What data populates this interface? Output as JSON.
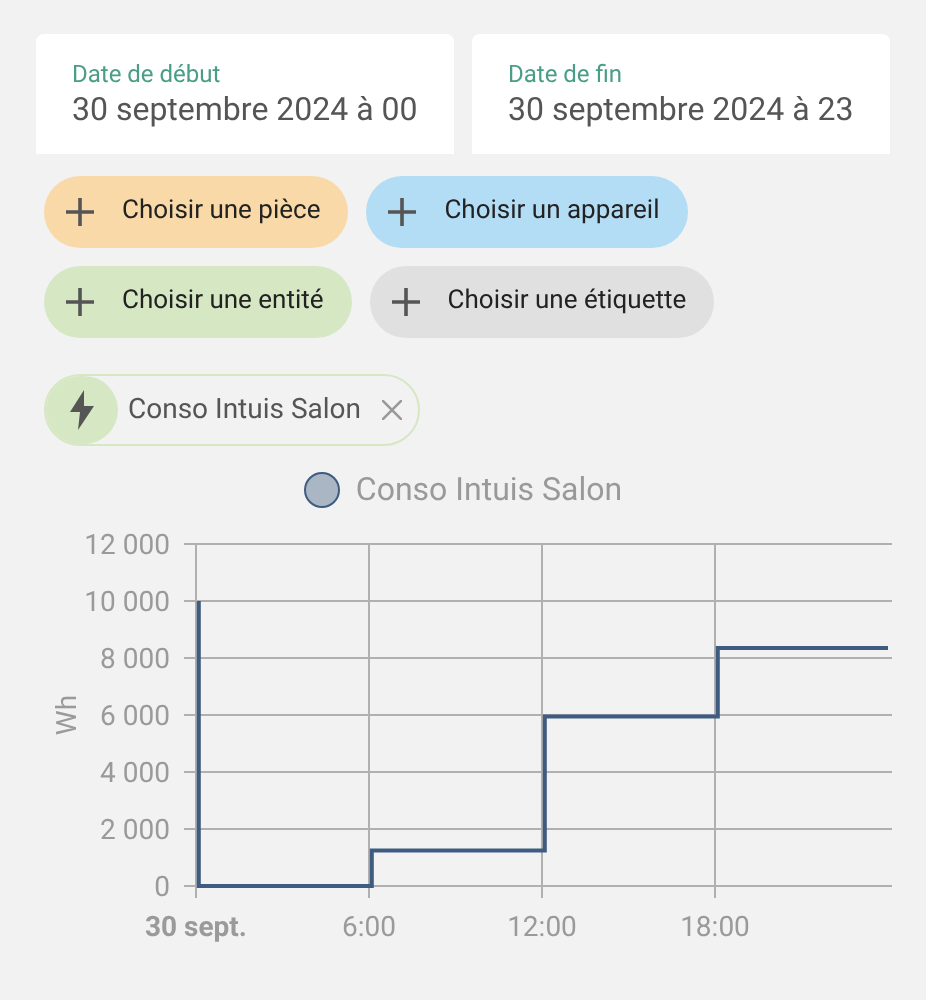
{
  "date_fields": [
    {
      "label": "Date de début",
      "value": "30 septembre 2024 à 00"
    },
    {
      "label": "Date de fin",
      "value": "30 septembre 2024 à 23"
    }
  ],
  "target_buttons": [
    {
      "label": "Choisir une pièce",
      "color": "#f9d9a8"
    },
    {
      "label": "Choisir un appareil",
      "color": "#b3dcf5"
    },
    {
      "label": "Choisir une entité",
      "color": "#d6e7c4"
    },
    {
      "label": "Choisir une étiquette",
      "color": "#e0e0e0"
    }
  ],
  "selected_chips": [
    {
      "label": "Conso Intuis Salon"
    }
  ],
  "chart": {
    "chart_data": {
      "type": "line",
      "grid": true,
      "ylabel": "Wh",
      "xlim": [
        0,
        24
      ],
      "ylim": [
        0,
        12000
      ],
      "xticks": [
        {
          "value": 0,
          "label": "30 sept."
        },
        {
          "value": 6,
          "label": "6:00"
        },
        {
          "value": 12,
          "label": "12:00"
        },
        {
          "value": 18,
          "label": "18:00"
        }
      ],
      "yticks": [
        {
          "value": 0,
          "label": "0"
        },
        {
          "value": 2000,
          "label": "2 000"
        },
        {
          "value": 4000,
          "label": "4 000"
        },
        {
          "value": 6000,
          "label": "6 000"
        },
        {
          "value": 8000,
          "label": "8 000"
        },
        {
          "value": 10000,
          "label": "10 000"
        },
        {
          "value": 12000,
          "label": "12 000"
        }
      ],
      "x": [
        0.1,
        0.1,
        6.1,
        6.1,
        12.1,
        12.1,
        18.1,
        18.1,
        24
      ],
      "series": [
        {
          "name": "Conso Intuis Salon",
          "color": "#3e5c80",
          "values": [
            10000,
            0,
            0,
            1250,
            1250,
            5950,
            5950,
            8350,
            8350
          ]
        }
      ]
    }
  }
}
